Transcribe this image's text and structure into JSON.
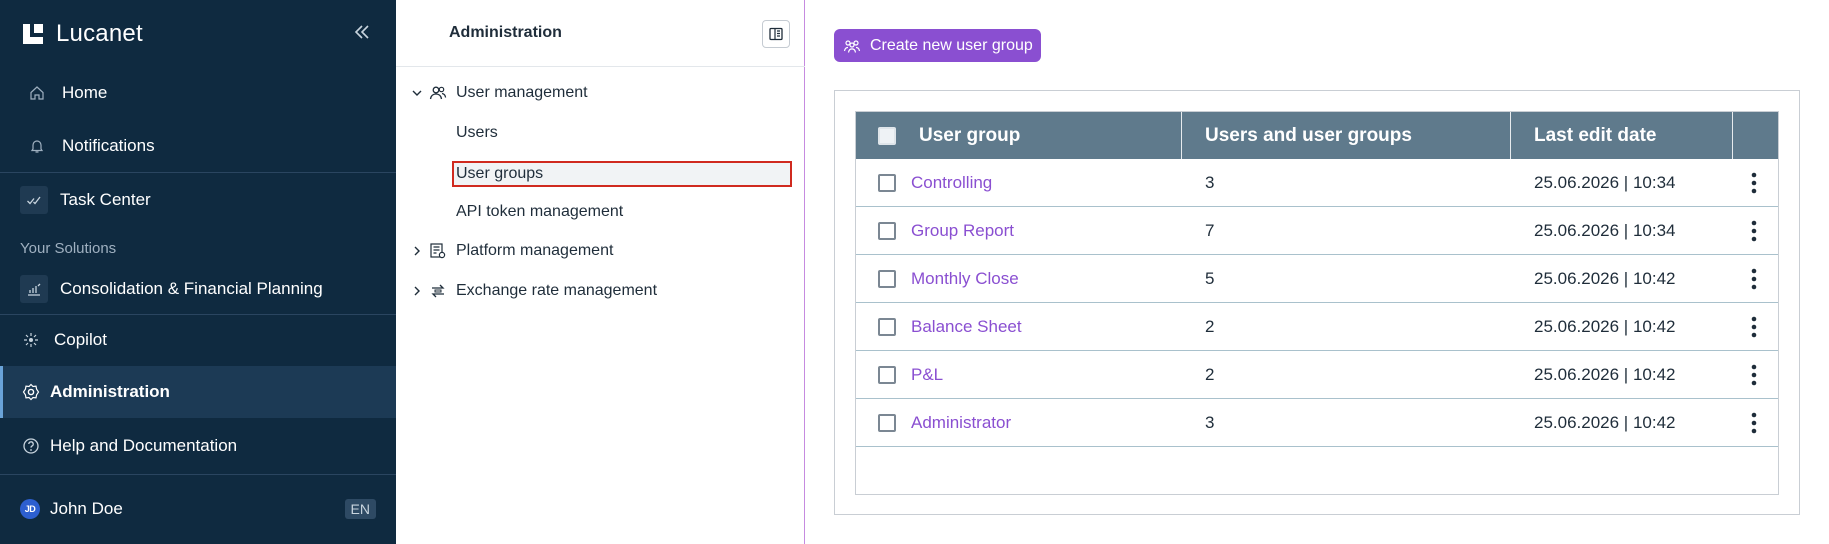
{
  "sidebar": {
    "brand": "Lucanet",
    "items": [
      {
        "label": "Home"
      },
      {
        "label": "Notifications"
      },
      {
        "label": "Task Center"
      },
      {
        "label": "Consolidation & Financial Planning"
      },
      {
        "label": "Copilot"
      },
      {
        "label": "Administration"
      },
      {
        "label": "Help and Documentation"
      }
    ],
    "section_label": "Your Solutions",
    "user": {
      "initials": "JD",
      "name": "John Doe",
      "language": "EN"
    }
  },
  "admin_panel": {
    "title": "Administration",
    "tree": {
      "user_management": "User management",
      "users": "Users",
      "user_groups": "User groups",
      "api_tokens": "API token management",
      "platform_management": "Platform management",
      "exchange_rate_management": "Exchange rate management"
    }
  },
  "main": {
    "create_button": "Create new user group",
    "table": {
      "headers": [
        "User group",
        "Users and user groups",
        "Last edit date"
      ],
      "rows": [
        {
          "name": "Controlling",
          "count": "3",
          "date": "25.06.2026 | 10:34"
        },
        {
          "name": "Group Report",
          "count": "7",
          "date": "25.06.2026 | 10:34"
        },
        {
          "name": "Monthly Close",
          "count": "5",
          "date": "25.06.2026 | 10:42"
        },
        {
          "name": "Balance Sheet",
          "count": "2",
          "date": "25.06.2026 | 10:42"
        },
        {
          "name": "P&L",
          "count": "2",
          "date": "25.06.2026 | 10:42"
        },
        {
          "name": "Administrator",
          "count": "3",
          "date": "25.06.2026 | 10:42"
        }
      ]
    }
  },
  "colors": {
    "sidebar_bg": "#0f2a40",
    "accent": "#8a4fd1",
    "table_header": "#5f7a8c",
    "selection_border": "#d02a1f"
  }
}
